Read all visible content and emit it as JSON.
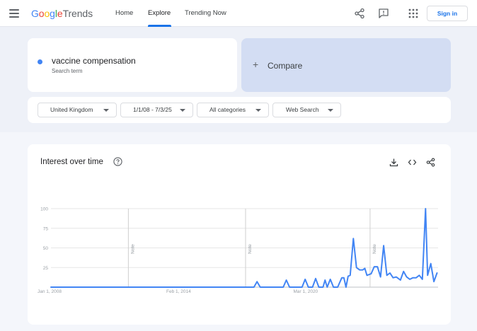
{
  "header": {
    "logo_google": "Google",
    "logo_trends": "Trends",
    "tabs": [
      {
        "label": "Home"
      },
      {
        "label": "Explore"
      },
      {
        "label": "Trending Now"
      }
    ],
    "signin_label": "Sign in"
  },
  "search": {
    "term": "vaccine compensation",
    "term_type": "Search term",
    "term_color": "#4285f4",
    "compare_label": "Compare"
  },
  "filters": {
    "region": "United Kingdom",
    "date_range": "1/1/08 - 7/3/25",
    "category": "All categories",
    "property": "Web Search"
  },
  "interest": {
    "title": "Interest over time"
  },
  "chart_data": {
    "type": "line",
    "title": "Interest over time",
    "x_start": "Jan 1, 2008",
    "x_end": "Jul 3, 2025",
    "x_tick_labels": [
      "Jan 1, 2008",
      "Feb 1, 2014",
      "Mar 1, 2020"
    ],
    "y_tick_labels": [
      "100",
      "75",
      "50",
      "25"
    ],
    "ylim": [
      0,
      100
    ],
    "grid": true,
    "series": [
      {
        "name": "vaccine compensation",
        "color": "#4285f4",
        "x": [
          2008.0,
          2017.7,
          2017.85,
          2018.0,
          2019.1,
          2019.25,
          2019.4,
          2020.0,
          2020.15,
          2020.3,
          2020.5,
          2020.65,
          2020.8,
          2021.0,
          2021.1,
          2021.2,
          2021.35,
          2021.5,
          2021.7,
          2021.9,
          2022.0,
          2022.1,
          2022.2,
          2022.3,
          2022.45,
          2022.6,
          2022.75,
          2022.9,
          2023.0,
          2023.1,
          2023.3,
          2023.45,
          2023.6,
          2023.75,
          2023.9,
          2024.05,
          2024.2,
          2024.35,
          2024.5,
          2024.7,
          2024.85,
          2025.0,
          2025.15,
          2025.3,
          2025.45,
          2025.6,
          2025.75,
          2025.9,
          2026.0,
          2026.15,
          2026.3,
          2026.45
        ],
        "values": [
          0,
          0,
          7,
          0,
          0,
          9,
          0,
          0,
          10,
          0,
          0,
          11,
          0,
          0,
          9,
          0,
          10,
          0,
          0,
          12,
          12,
          0,
          14,
          15,
          62,
          25,
          22,
          22,
          24,
          15,
          17,
          26,
          26,
          13,
          53,
          15,
          18,
          12,
          13,
          9,
          20,
          13,
          10,
          12,
          12,
          15,
          10,
          100,
          15,
          30,
          7,
          18
        ]
      }
    ],
    "annotations": [
      "Note",
      "Note",
      "Note"
    ]
  }
}
